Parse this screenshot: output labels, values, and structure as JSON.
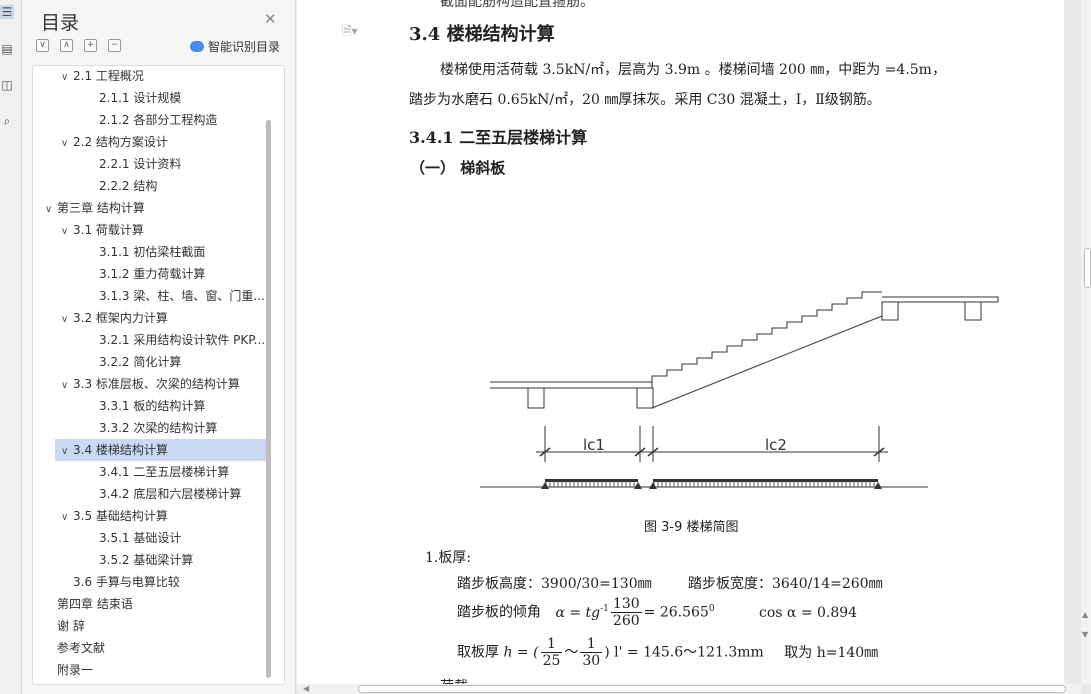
{
  "toc": {
    "title": "目录",
    "smart_label": "智能识别目录",
    "items": [
      {
        "label": "2.1  工程概况",
        "level": 1,
        "caret": "∨"
      },
      {
        "label": "2.1.1 设计规模",
        "level": 2
      },
      {
        "label": "2.1.2  各部分工程构造",
        "level": 2
      },
      {
        "label": "2.2  结构方案设计",
        "level": 1,
        "caret": "∨"
      },
      {
        "label": "2.2.1 设计资料",
        "level": 2
      },
      {
        "label": "2.2.2  结构",
        "level": 2
      },
      {
        "label": "第三章    结构计算",
        "level": 0,
        "caret": "∨"
      },
      {
        "label": "3.1 荷载计算",
        "level": 1,
        "caret": "∨"
      },
      {
        "label": "3.1.1  初估梁柱截面",
        "level": 2
      },
      {
        "label": "3.1.2  重力荷载计算",
        "level": 2
      },
      {
        "label": "3.1.3  梁、柱、墙、窗、门重...",
        "level": 2
      },
      {
        "label": "3.2  框架内力计算",
        "level": 1,
        "caret": "∨"
      },
      {
        "label": "3.2.1 采用结构设计软件 PKP...",
        "level": 2
      },
      {
        "label": "3.2.2  简化计算",
        "level": 2
      },
      {
        "label": "3.3 标准层板、次梁的结构计算",
        "level": 1,
        "caret": "∨"
      },
      {
        "label": "3.3.1 板的结构计算",
        "level": 2
      },
      {
        "label": "3.3.2 次梁的结构计算",
        "level": 2
      },
      {
        "label": "3.4 楼梯结构计算",
        "level": 1,
        "caret": "∨",
        "selected": true
      },
      {
        "label": "3.4.1  二至五层楼梯计算",
        "level": 2
      },
      {
        "label": "3.4.2  底层和六层楼梯计算",
        "level": 2
      },
      {
        "label": "3.5 基础结构计算",
        "level": 1,
        "caret": "∨"
      },
      {
        "label": "3.5.1  基础设计",
        "level": 2
      },
      {
        "label": "3.5.2  基础梁计算",
        "level": 2
      },
      {
        "label": "3.6  手算与电算比较",
        "level": 1
      },
      {
        "label": "第四章  结束语",
        "level": 0
      },
      {
        "label": "谢  辞",
        "level": 0
      },
      {
        "label": "参考文献",
        "level": 0
      },
      {
        "label": "附录一",
        "level": 0
      }
    ]
  },
  "doc": {
    "top_cut": "截面配筋构造配置箍筋。",
    "heading": "3.4 楼梯结构计算",
    "para1": "楼梯使用活荷载 3.5kN/㎡，层高为 3.9m 。楼梯间墙 200 ㎜，中距为 =4.5m，",
    "para2": "踏步为水磨石 0.65kN/㎡，20 ㎜厚抹灰。采用 C30 混凝土，Ⅰ，Ⅱ级钢筋。",
    "subheading": "3.4.1 二至五层楼梯计算",
    "section": "（一）  梯斜板",
    "fig_labels": {
      "lc1": "lc1",
      "lc2": "lc2"
    },
    "caption": "图 3-9    楼梯简图",
    "item1": "1.板厚:",
    "line_a": "踏步板高度：3900/30=130㎜",
    "line_b": "踏步板宽度：3640/14=260㎜",
    "line_c_label": "踏步板的倾角",
    "line_c_alpha": "α = tg",
    "line_c_sup": "-1",
    "line_c_num": "130",
    "line_c_den": "260",
    "line_c_res": "= 26.565",
    "line_c_deg": "0",
    "line_c_cos": "cos α = 0.894",
    "line_d_label": "取板厚",
    "line_d_h": "h = (",
    "line_d_n1": "1",
    "line_d_d1": "25",
    "line_d_tilde": "～",
    "line_d_n2": "1",
    "line_d_d2": "30",
    "line_d_rest": ") l' = 145.6～121.3mm",
    "line_d_take": "取为 h=140㎜",
    "bottom_cut": "荷载"
  }
}
